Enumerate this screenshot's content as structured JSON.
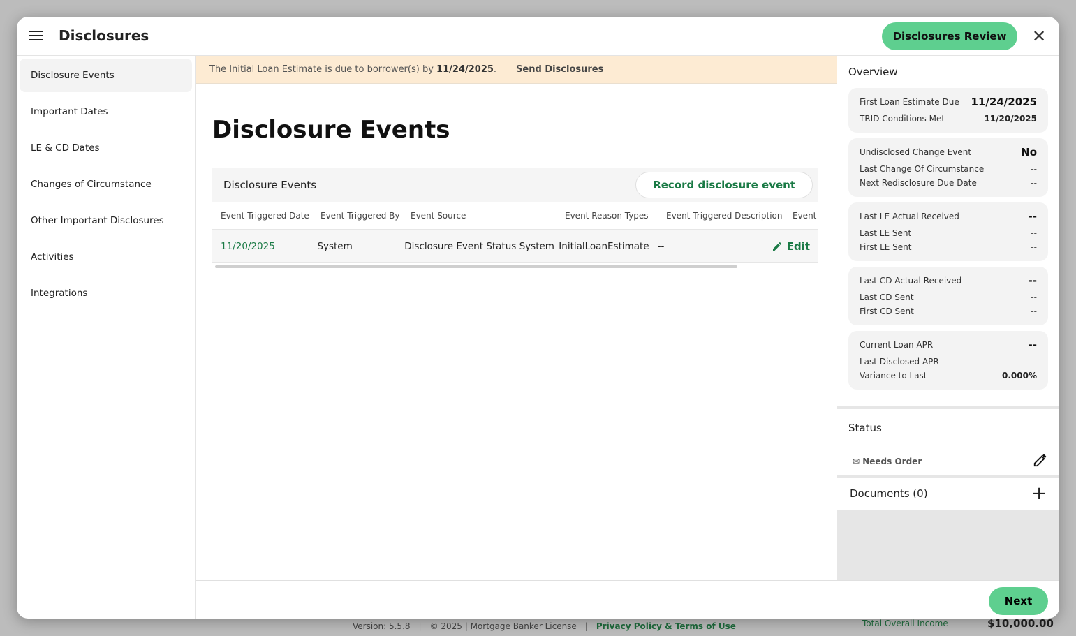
{
  "background": {
    "version": "Version: 5.5.8",
    "copyright": "© 2025 | Mortgage Banker License",
    "privacy": "Privacy Policy & Terms of Use",
    "income_label": "Total Overall Income",
    "income_value": "$10,000.00"
  },
  "header": {
    "title": "Disclosures",
    "review_button": "Disclosures Review",
    "close": "✕"
  },
  "sidebar": {
    "items": [
      {
        "label": "Disclosure Events"
      },
      {
        "label": "Important Dates"
      },
      {
        "label": "LE & CD Dates"
      },
      {
        "label": "Changes of Circumstance"
      },
      {
        "label": "Other Important Disclosures"
      },
      {
        "label": "Activities"
      },
      {
        "label": "Integrations"
      }
    ]
  },
  "banner": {
    "text": "The Initial Loan Estimate is due to borrower(s) by",
    "date": "11/24/2025",
    "period": ".",
    "action": "Send Disclosures"
  },
  "main": {
    "title": "Disclosure Events",
    "table": {
      "title": "Disclosure Events",
      "record_button": "Record disclosure event",
      "columns": [
        "Event Triggered Date",
        "Event Triggered By",
        "Event Source",
        "Event Reason Types",
        "Event Triggered Description",
        "Event S"
      ],
      "rows": [
        {
          "date": "11/20/2025",
          "by": "System",
          "source": "Disclosure Event Status System",
          "reason": "InitialLoanEstimate",
          "description": "--",
          "edit": "Edit"
        }
      ]
    }
  },
  "overview": {
    "title": "Overview",
    "cards": [
      [
        {
          "k": "First Loan Estimate Due",
          "v": "11/24/2025",
          "style": "big"
        },
        {
          "k": "TRID Conditions Met",
          "v": "11/20/2025",
          "style": "vb"
        }
      ],
      [
        {
          "k": "Undisclosed Change Event",
          "v": "No",
          "style": "big"
        },
        {
          "k": "Last Change Of Circumstance",
          "v": "--"
        },
        {
          "k": "Next Redisclosure Due Date",
          "v": "--"
        }
      ],
      [
        {
          "k": "Last LE Actual Received",
          "v": "--",
          "style": "big"
        },
        {
          "k": "Last LE Sent",
          "v": "--"
        },
        {
          "k": "First LE Sent",
          "v": "--"
        }
      ],
      [
        {
          "k": "Last CD Actual Received",
          "v": "--",
          "style": "big"
        },
        {
          "k": "Last CD Sent",
          "v": "--"
        },
        {
          "k": "First CD Sent",
          "v": "--"
        }
      ],
      [
        {
          "k": "Current Loan APR",
          "v": "--",
          "style": "big"
        },
        {
          "k": "Last Disclosed APR",
          "v": "--"
        },
        {
          "k": "Variance to Last",
          "v": "0.000%",
          "style": "vb"
        }
      ]
    ]
  },
  "status": {
    "title": "Status",
    "value": "Needs Order"
  },
  "documents": {
    "title": "Documents (0)"
  },
  "footer": {
    "next": "Next"
  },
  "colors": {
    "accent": "#5ecf8f",
    "link_green": "#1a7a45",
    "banner": "#fdebd3"
  }
}
